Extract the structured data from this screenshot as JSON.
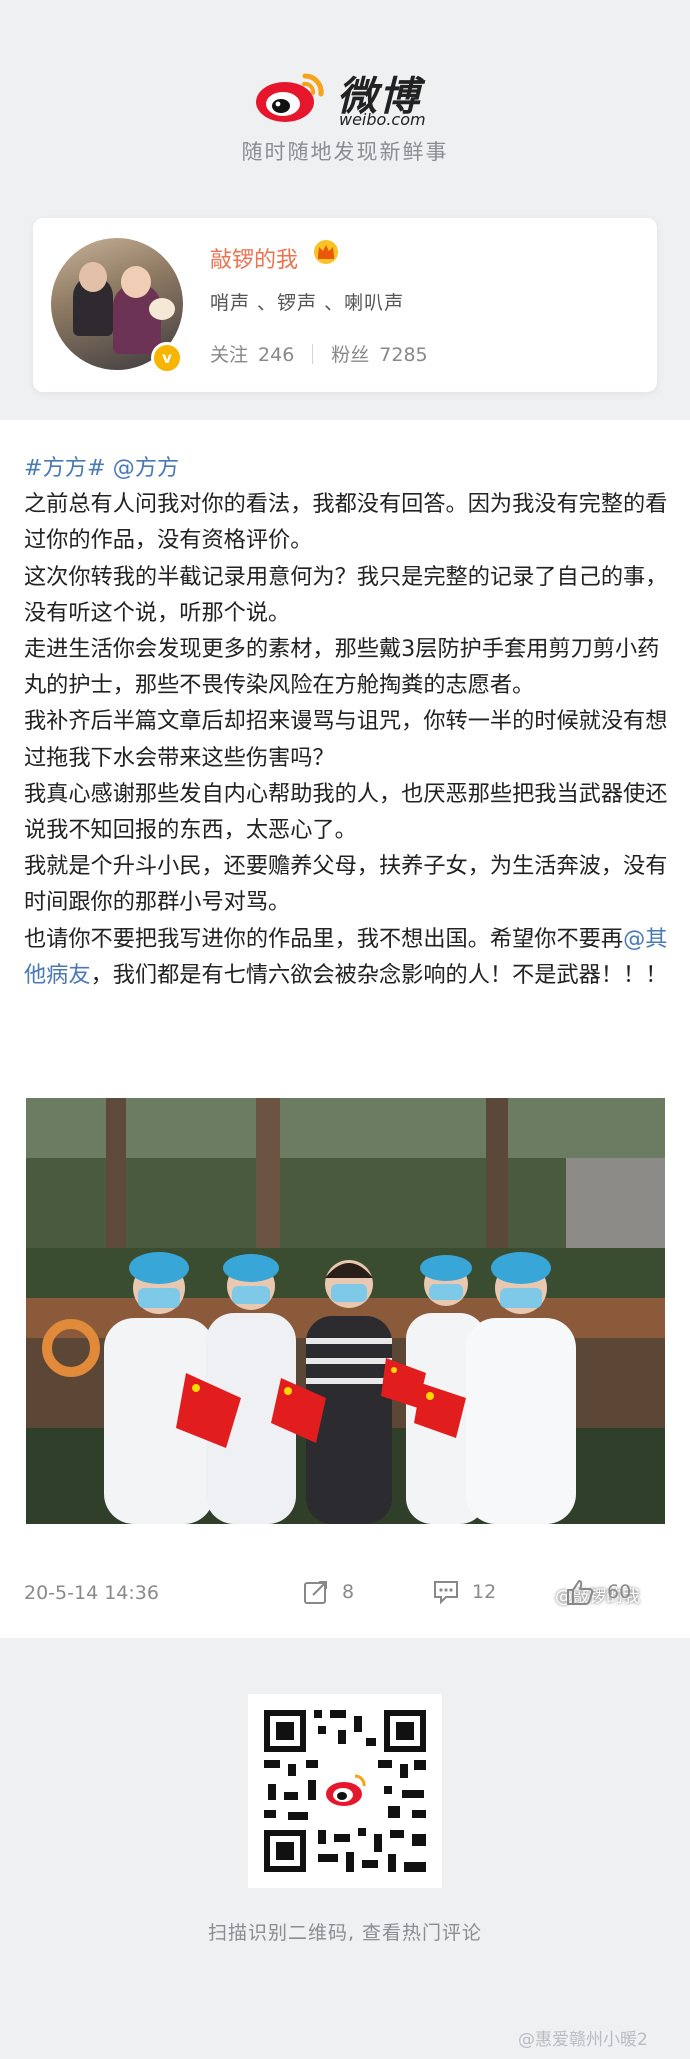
{
  "brand": {
    "logo_cn": "微博",
    "logo_en": "weibo.com",
    "tagline": "随时随地发现新鲜事"
  },
  "profile": {
    "nickname": "敲锣的我",
    "bio": "哨声 、锣声 、喇叭声",
    "following_label": "关注",
    "following_count": "246",
    "followers_label": "粉丝",
    "followers_count": "7285",
    "verified_badge": "v"
  },
  "post": {
    "tag": "#方方#",
    "mention": "@方方",
    "paragraphs": [
      "之前总有人问我对你的看法，我都没有回答。因为我没有完整的看过你的作品，没有资格评价。",
      "这次你转我的半截记录用意何为？我只是完整的记录了自己的事，没有听这个说，听那个说。",
      "走进生活你会发现更多的素材，那些戴3层防护手套用剪刀剪小药丸的护士，那些不畏传染风险在方舱掏粪的志愿者。",
      "我补齐后半篇文章后却招来谩骂与诅咒，你转一半的时候就没有想过拖我下水会带来这些伤害吗？",
      "我真心感谢那些发自内心帮助我的人，也厌恶那些把我当武器使还说我不知回报的东西，太恶心了。",
      "我就是个升斗小民，还要赡养父母，扶养子女，为生活奔波，没有时间跟你的那群小号对骂。"
    ],
    "last_paragraph_before": "也请你不要把我写进你的作品里，我不想出国。希望你不要再",
    "last_paragraph_mention": "@其他病友",
    "last_paragraph_after": "，我们都是有七情六欲会被杂念影响的人！不是武器！！！",
    "image_watermark": "@敲锣的我",
    "timestamp": "20-5-14 14:36",
    "reposts": "8",
    "comments": "12",
    "likes": "60"
  },
  "footer": {
    "qr_hint": "扫描识别二维码, 查看热门评论",
    "bottom_watermark": "@惠爱赣州小暖2"
  },
  "icons": {
    "repost": "repost-icon",
    "comment": "comment-icon",
    "like": "thumbs-up-icon",
    "crown": "crown-icon"
  },
  "colors": {
    "accent_orange": "#eb7350",
    "link_blue": "#4a79b5",
    "page_bg": "#eff0f2"
  }
}
